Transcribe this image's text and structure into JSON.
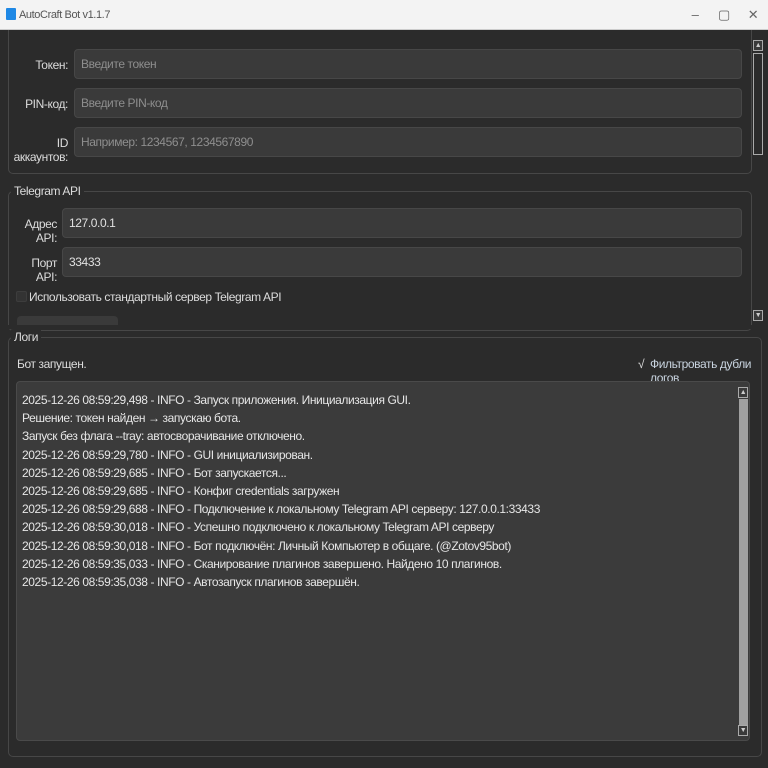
{
  "window": {
    "title": "AutoCraft Bot v1.1.7",
    "minimize": "–",
    "maximize": "▢",
    "close": "✕"
  },
  "credentials": {
    "token": {
      "label": "Токен:",
      "placeholder": "Введите токен"
    },
    "pin": {
      "label": "PIN-код:",
      "placeholder": "Введите PIN-код"
    },
    "accounts": {
      "label": "ID аккаунтов:",
      "placeholder": "Например: 1234567, 1234567890"
    }
  },
  "telegram_api": {
    "title": "Telegram API",
    "address": {
      "label": "Адрес API:",
      "value": "127.0.0.1"
    },
    "port": {
      "label": "Порт API:",
      "value": "33433"
    },
    "use_default": {
      "label": "Использовать стандартный сервер Telegram API",
      "checked": false
    }
  },
  "logs": {
    "title": "Логи",
    "status": "Бот запущен.",
    "filter": {
      "label": "Фильтровать дубли логов",
      "checked": true,
      "mark": "√"
    },
    "lines": [
      "2025-12-26 08:59:29,498 - INFO - Запуск приложения. Инициализация GUI.",
      "Решение: токен найден → запускаю бота.",
      "Запуск без флага --tray: автосворачивание отключено.",
      "2025-12-26 08:59:29,780 - INFO - GUI инициализирован.",
      "2025-12-26 08:59:29,685 - INFO - Бот запускается...",
      "2025-12-26 08:59:29,685 - INFO - Конфиг credentials загружен",
      "2025-12-26 08:59:29,688 - INFO - Подключение к локальному Telegram API серверу: 127.0.0.1:33433",
      "2025-12-26 08:59:30,018 - INFO - Успешно подключено к локальному Telegram API серверу",
      "2025-12-26 08:59:30,018 - INFO - Бот подключён: Личный Компьютер в общаге. (@Zotov95bot)",
      "2025-12-26 08:59:35,033 - INFO - Сканирование плагинов завершено. Найдено 10 плагинов.",
      "2025-12-26 08:59:35,038 - INFO - Автозапуск плагинов завершён."
    ]
  }
}
